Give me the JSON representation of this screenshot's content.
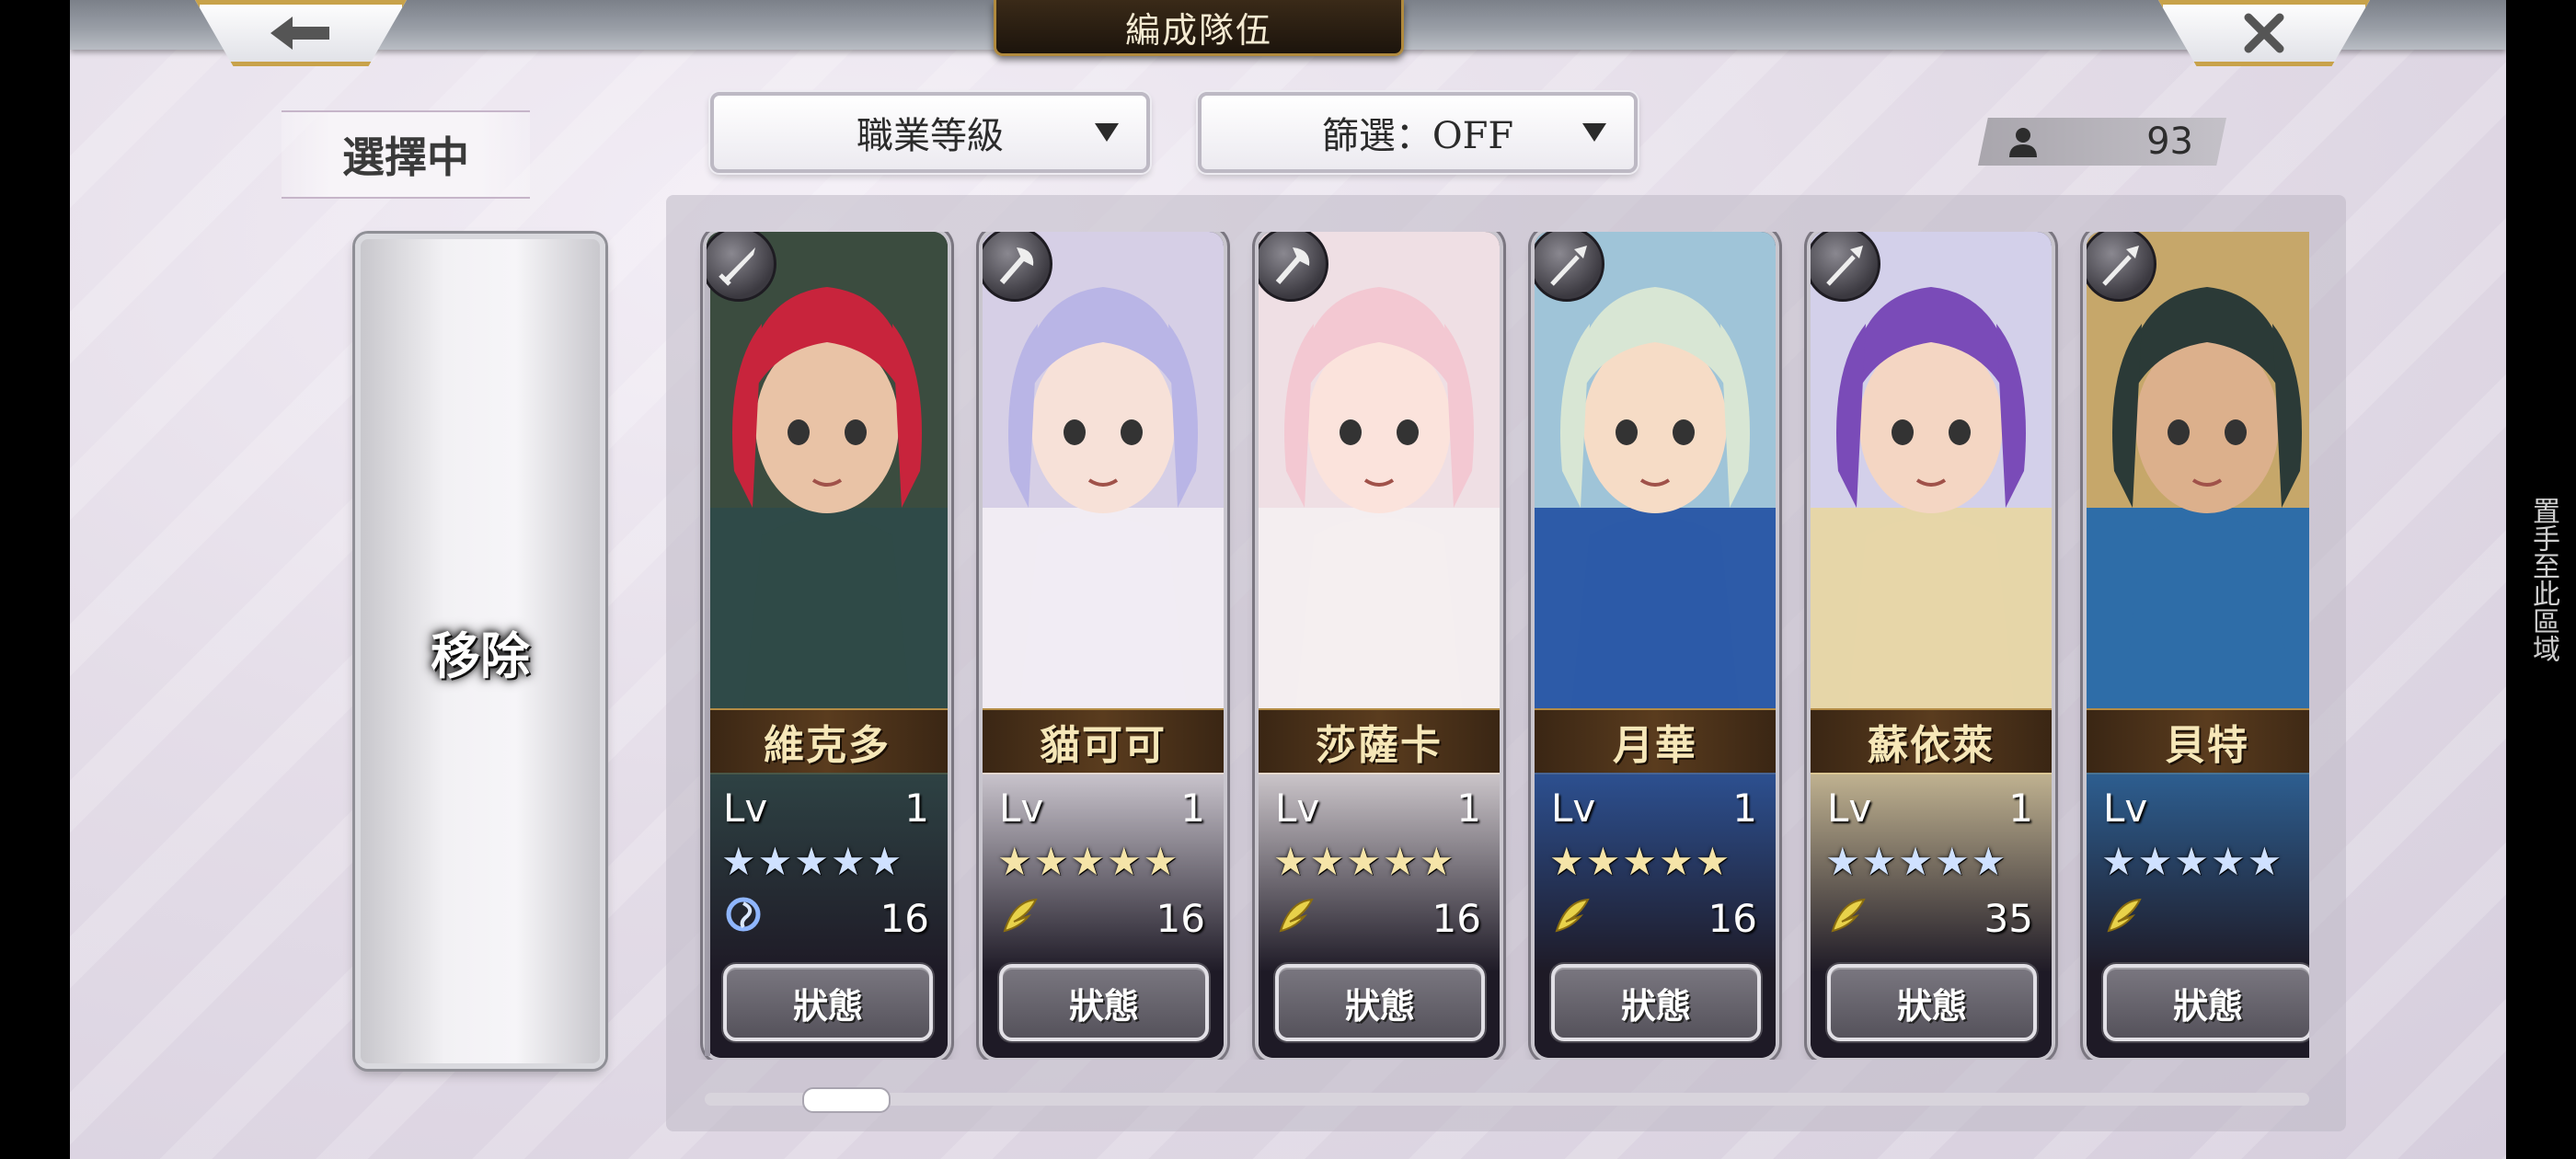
{
  "header": {
    "title": "編成隊伍",
    "back_icon": "arrow-left-icon",
    "close_icon": "close-icon"
  },
  "left_panel": {
    "selecting_label": "選擇中",
    "remove_label": "移除"
  },
  "filters": {
    "sort_label": "職業等級",
    "filter_label": "篩選：OFF"
  },
  "unit_count": "93",
  "characters": [
    {
      "name": "維克多",
      "lv_label": "Lv",
      "level": "1",
      "star_color": "blue",
      "cost_icon": "spiral-element-icon",
      "cost": "16",
      "status_label": "狀態",
      "class_icon": "sword-class-icon",
      "hair": "#c8243c",
      "outfit": "#2f4a48",
      "skin": "#e9c3a6",
      "bg": "#3b4c3f"
    },
    {
      "name": "貓可可",
      "lv_label": "Lv",
      "level": "1",
      "star_color": "gold",
      "cost_icon": "feather-element-icon",
      "cost": "16",
      "status_label": "狀態",
      "class_icon": "axe-class-icon",
      "hair": "#b9b5e6",
      "outfit": "#f1ecf3",
      "skin": "#f7e1d8",
      "bg": "#d6cfe6"
    },
    {
      "name": "莎薩卡",
      "lv_label": "Lv",
      "level": "1",
      "star_color": "gold",
      "cost_icon": "feather-element-icon",
      "cost": "16",
      "status_label": "狀態",
      "class_icon": "axe-class-icon",
      "hair": "#f3c8d2",
      "outfit": "#f4eef0",
      "skin": "#fbe3dc",
      "bg": "#efdfe4"
    },
    {
      "name": "月華",
      "lv_label": "Lv",
      "level": "1",
      "star_color": "gold",
      "cost_icon": "feather-element-icon",
      "cost": "16",
      "status_label": "狀態",
      "class_icon": "spear-class-icon",
      "hair": "#d8e6d4",
      "outfit": "#2d5ba8",
      "skin": "#f6dcc6",
      "bg": "#9fc4d8"
    },
    {
      "name": "蘇依萊",
      "lv_label": "Lv",
      "level": "1",
      "star_color": "blue",
      "cost_icon": "feather-element-icon",
      "cost": "35",
      "status_label": "狀態",
      "class_icon": "spear-class-icon",
      "hair": "#7a4bb8",
      "outfit": "#e6d6a8",
      "skin": "#f4d6c3",
      "bg": "#d3d0ea"
    },
    {
      "name": "貝特",
      "lv_label": "Lv",
      "level": "",
      "star_color": "blue",
      "cost_icon": "feather-element-icon",
      "cost": "",
      "status_label": "狀態",
      "class_icon": "spear-class-icon",
      "hair": "#2b3a37",
      "outfit": "#2e6da8",
      "skin": "#dcb08c",
      "bg": "#c6a76a"
    }
  ],
  "side_hint": "置手至此區域",
  "colors": {
    "accent_gold": "#c8a24a",
    "name_band": "#5a3c1e",
    "star_blue": "#cfe1ff",
    "star_gold": "#f5e4a8"
  }
}
